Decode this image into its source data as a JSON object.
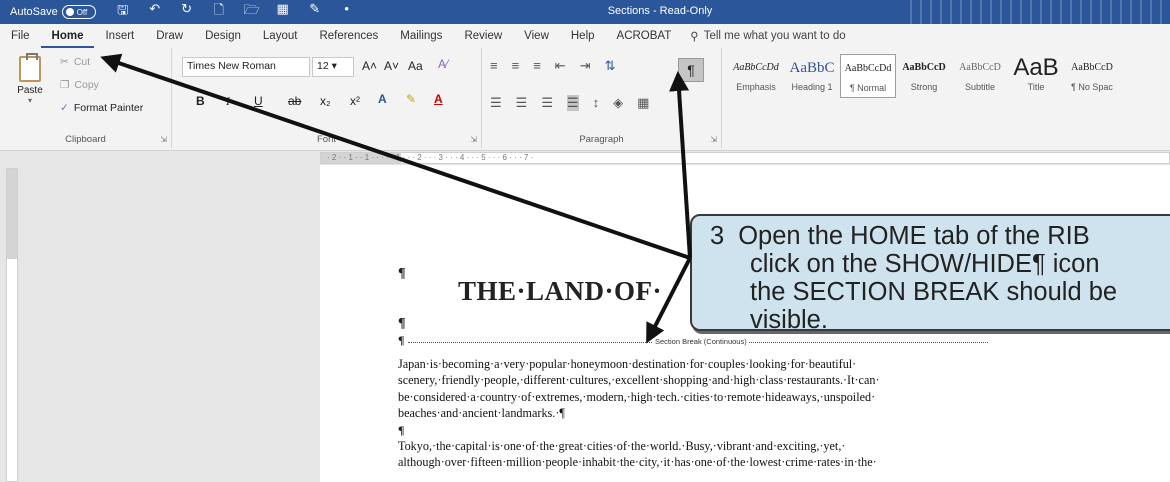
{
  "titlebar": {
    "autosave_label": "AutoSave",
    "autosave_state": "Off",
    "doc_title": "Sections  -  Read-Only",
    "bg_color": "#2b579a"
  },
  "menu": {
    "tabs": [
      "File",
      "Home",
      "Insert",
      "Draw",
      "Design",
      "Layout",
      "References",
      "Mailings",
      "Review",
      "View",
      "Help",
      "ACROBAT"
    ],
    "active_tab": "Home",
    "tell_me": "Tell me what you want to do"
  },
  "clipboard": {
    "paste": "Paste",
    "cut": "Cut",
    "copy": "Copy",
    "format_painter": "Format Painter",
    "label": "Clipboard"
  },
  "font": {
    "name": "Times New Roman",
    "size": "12",
    "grow": "A˄",
    "shrink": "A˅",
    "case": "Aa",
    "bold": "B",
    "italic": "I",
    "underline": "U",
    "strike": "ab",
    "subscript": "x₂",
    "superscript": "x²",
    "label": "Font"
  },
  "paragraph": {
    "label": "Paragraph",
    "show_hide": "¶"
  },
  "styles": [
    {
      "sample": "AaBbCcDd",
      "name": "Emphasis"
    },
    {
      "sample": "AaBbC",
      "name": "Heading 1"
    },
    {
      "sample": "AaBbCcDd",
      "name": "¶ Normal"
    },
    {
      "sample": "AaBbCcD",
      "name": "Strong"
    },
    {
      "sample": "AaBbCcD",
      "name": "Subtitle"
    },
    {
      "sample": "AaB",
      "name": "Title"
    },
    {
      "sample": "AaBbCcD",
      "name": "¶ No Spac"
    }
  ],
  "ruler": {
    "ticks": "· 2 · · 1 · · 1 · · ·   · · 1 · · · 2 · · · 3 · · · 4 · · · 5 · · · 6 · · · 7 ·"
  },
  "document": {
    "pilcrow": "¶",
    "heading": "THE·LAND·OF·",
    "section_break": "Section Break (Continuous)",
    "para1": "Japan·is·becoming·a·very·popular·honeymoon·destination·for·couples·looking·for·beautiful· scenery,·friendly·people,·different·cultures,·excellent·shopping·and·high·class·restaurants.·It·can· be·considered·a·country·of·extremes,·modern,·high·tech.·cities·to·remote·hideaways,·unspoiled· beaches·and·ancient·landmarks.·¶",
    "para2": "Tokyo,·the·capital·is·one·of·the·great·cities·of·the·world.·Busy,·vibrant·and·exciting,·yet,· although·over·fifteen·million·people·inhabit·the·city,·it·has·one·of·the·lowest·crime·rates·in·the·"
  },
  "callout": {
    "number": "3",
    "line1": "Open the HOME tab of the RIB",
    "line2": "click on the SHOW/HIDE¶ icon",
    "line3": "the SECTION BREAK should be",
    "line4": "visible.",
    "bg_color": "#cfe3ee"
  }
}
